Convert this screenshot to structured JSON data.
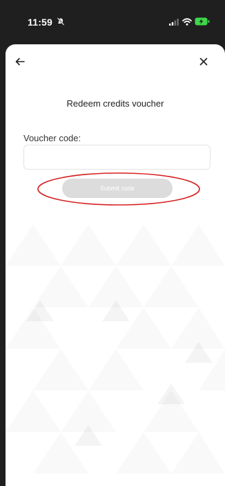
{
  "status_bar": {
    "time": "11:59",
    "icons": [
      "silent-mode-icon",
      "signal-icon",
      "wifi-icon",
      "battery-icon"
    ],
    "battery_color": "#3fd64a"
  },
  "header": {
    "back_icon": "back-arrow-icon",
    "close_icon": "close-icon"
  },
  "main": {
    "title": "Redeem credits voucher",
    "voucher_label": "Voucher code:",
    "voucher_value": "",
    "voucher_placeholder": "",
    "submit_label": "Submit code",
    "submit_enabled": false
  },
  "annotation": {
    "highlight_color": "#d62020"
  }
}
